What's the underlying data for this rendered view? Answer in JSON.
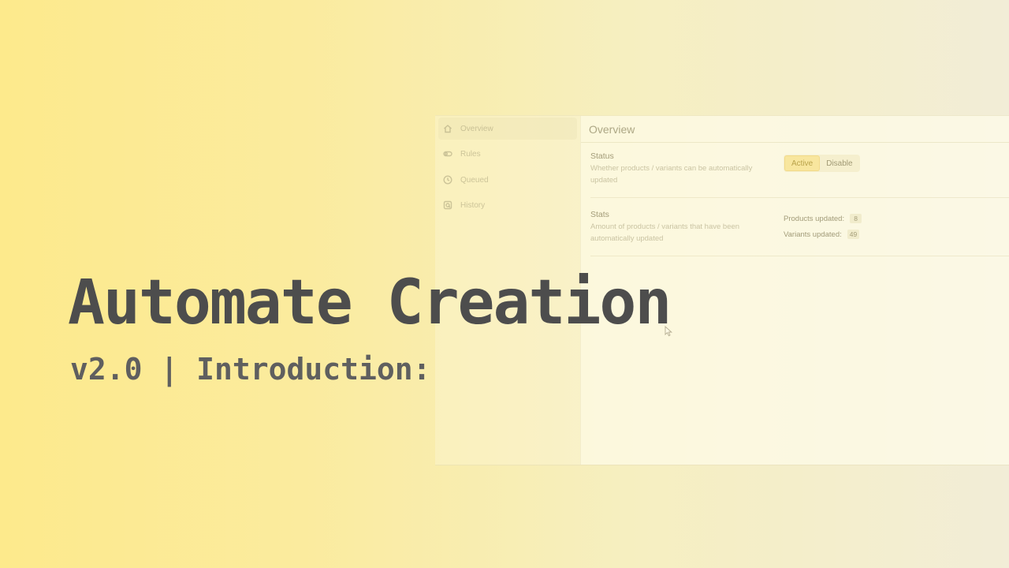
{
  "background": {
    "colors": [
      "#fdea8c",
      "#f2edd7"
    ]
  },
  "app": {
    "sidebar": {
      "items": [
        {
          "label": "Overview",
          "icon": "home-icon",
          "active": true
        },
        {
          "label": "Rules",
          "icon": "toggle-icon",
          "active": false
        },
        {
          "label": "Queued",
          "icon": "clock-icon",
          "active": false
        },
        {
          "label": "History",
          "icon": "history-icon",
          "active": false
        }
      ]
    },
    "main": {
      "title": "Overview",
      "status": {
        "title": "Status",
        "description": "Whether products / variants can be automatically updated",
        "active_label": "Active",
        "disable_label": "Disable"
      },
      "stats": {
        "title": "Stats",
        "description": "Amount of products / variants that have been automatically updated",
        "products_label": "Products updated:",
        "products_value": "8",
        "variants_label": "Variants updated:",
        "variants_value": "49"
      }
    }
  },
  "overlay": {
    "title": "Automate Creation",
    "subtitle": "v2.0 | Introduction:",
    "title_color": "#4d4d4d",
    "subtitle_color": "#5f5f5f"
  },
  "cursor": {
    "icon": "pointer-cursor-icon"
  }
}
